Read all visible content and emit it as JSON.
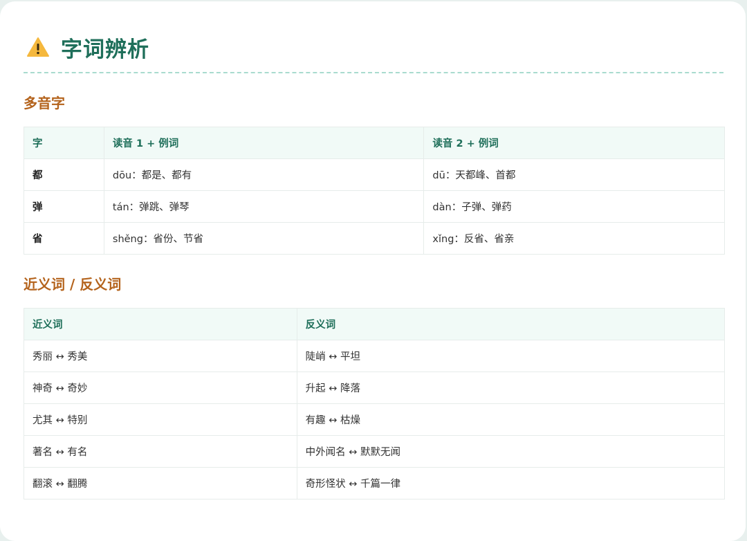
{
  "page": {
    "title": "字词辨析",
    "icon": "warning-icon"
  },
  "polyphone": {
    "section_title": "多音字",
    "headers": [
      "字",
      "读音 1 + 例词",
      "读音 2 + 例词"
    ],
    "rows": [
      [
        "都",
        "dōu：都是、都有",
        "dū：天都峰、首都"
      ],
      [
        "弹",
        "tán：弹跳、弹琴",
        "dàn：子弹、弹药"
      ],
      [
        "省",
        "shěng：省份、节省",
        "xǐng：反省、省亲"
      ]
    ]
  },
  "synonyms": {
    "section_title": "近义词 / 反义词",
    "headers": [
      "近义词",
      "反义词"
    ],
    "rows": [
      [
        "秀丽 ↔ 秀美",
        "陡峭 ↔ 平坦"
      ],
      [
        "神奇 ↔ 奇妙",
        "升起 ↔ 降落"
      ],
      [
        "尤其 ↔ 特别",
        "有趣 ↔ 枯燥"
      ],
      [
        "著名 ↔ 有名",
        "中外闻名 ↔ 默默无闻"
      ],
      [
        "翻滚 ↔ 翻腾",
        "奇形怪状 ↔ 千篇一律"
      ]
    ]
  },
  "colors": {
    "title": "#1f6f5a",
    "section": "#b4631c",
    "header_bg": "#f1faf7",
    "divider": "#a9dbcf",
    "warning": "#f5b83d"
  }
}
